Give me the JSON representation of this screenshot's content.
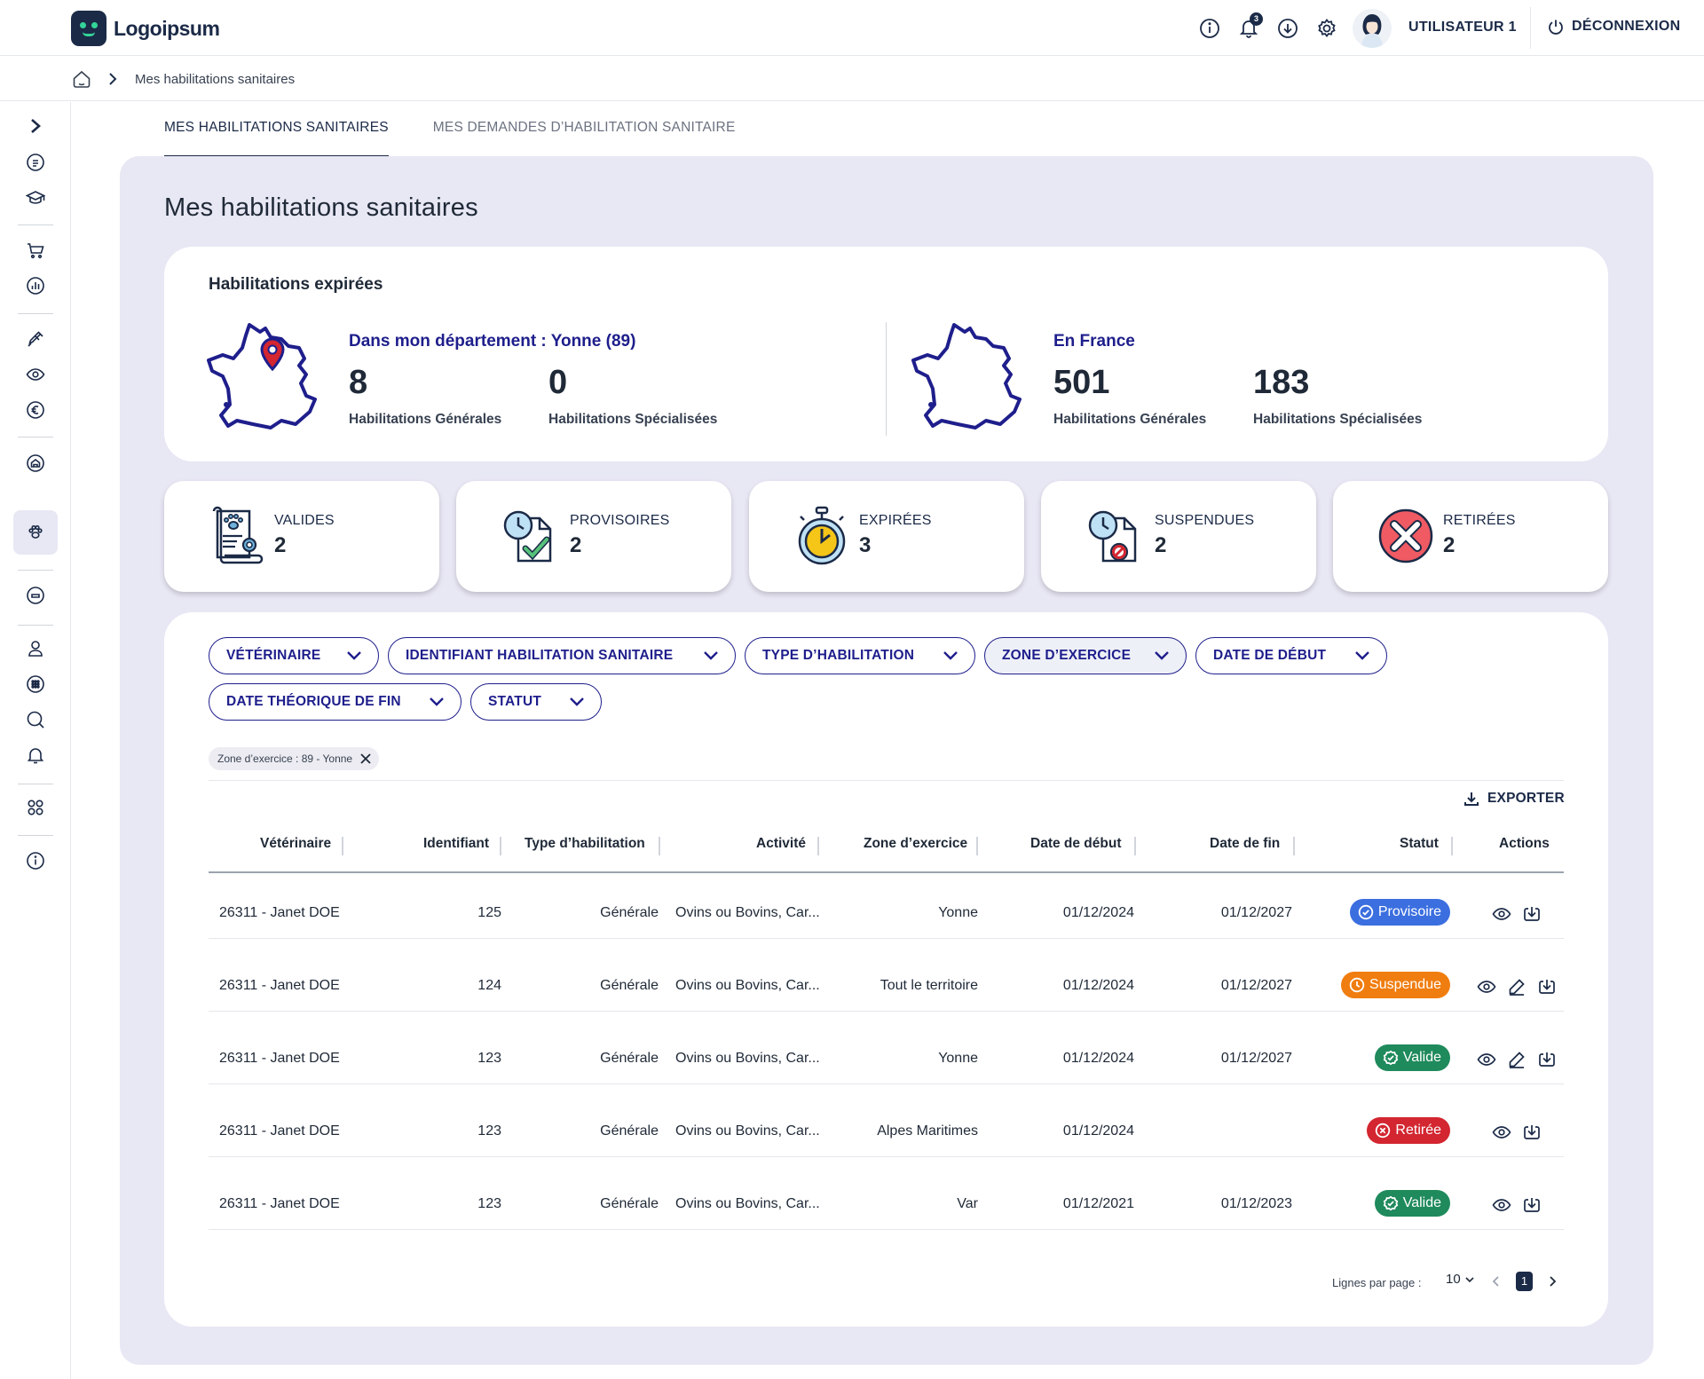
{
  "app": {
    "logo_text": "Logoipsum"
  },
  "header": {
    "notification_count": "3",
    "user_name": "UTILISATEUR 1",
    "logout_label": "DÉCONNEXION"
  },
  "breadcrumb": {
    "current": "Mes habilitations sanitaires"
  },
  "tabs": [
    {
      "label": "MES HABILITATIONS SANITAIRES",
      "active": true
    },
    {
      "label": "MES DEMANDES D’HABILITATION SANITAIRE",
      "active": false
    }
  ],
  "page_title": "Mes habilitations sanitaires",
  "expired": {
    "title": "Habilitations expirées",
    "department": {
      "title": "Dans mon département : Yonne (89)",
      "general_value": "8",
      "general_label": "Habilitations Générales",
      "special_value": "0",
      "special_label": "Habilitations Spécialisées"
    },
    "france": {
      "title": "En France",
      "general_value": "501",
      "general_label": "Habilitations Générales",
      "special_value": "183",
      "special_label": "Habilitations Spécialisées"
    }
  },
  "stats": [
    {
      "label": "VALIDES",
      "value": "2",
      "icon": "certificate-icon"
    },
    {
      "label": "PROVISOIRES",
      "value": "2",
      "icon": "clock-document-check-icon"
    },
    {
      "label": "EXPIRÉES",
      "value": "3",
      "icon": "stopwatch-icon"
    },
    {
      "label": "SUSPENDUES",
      "value": "2",
      "icon": "clock-document-forbidden-icon"
    },
    {
      "label": "RETIRÉES",
      "value": "2",
      "icon": "red-cross-icon"
    }
  ],
  "filters": [
    {
      "label": "VÉTÉRINAIRE"
    },
    {
      "label": "IDENTIFIANT HABILITATION SANITAIRE"
    },
    {
      "label": "TYPE D’HABILITATION"
    },
    {
      "label": "ZONE D’EXERCICE"
    },
    {
      "label": "DATE DE DÉBUT"
    },
    {
      "label": "DATE THÉORIQUE DE FIN"
    },
    {
      "label": "STATUT"
    }
  ],
  "active_filter_chip": "Zone d’exercice : 89 - Yonne",
  "export_label": "EXPORTER",
  "table": {
    "columns": [
      "Vétérinaire",
      "Identifiant",
      "Type d’habilitation",
      "Activité",
      "Zone d’exercice",
      "Date de début",
      "Date de fin",
      "Statut",
      "Actions"
    ],
    "rows": [
      {
        "vet": "26311 - Janet DOE",
        "id": "125",
        "type": "Générale",
        "activity": "Ovins ou Bovins, Car...",
        "zone": "Yonne",
        "start": "01/12/2024",
        "end": "01/12/2027",
        "status": "Provisoire",
        "status_color": "#3b6fe0",
        "actions": [
          "eye-icon",
          "download-icon"
        ]
      },
      {
        "vet": "26311 - Janet DOE",
        "id": "124",
        "type": "Générale",
        "activity": "Ovins ou Bovins, Car...",
        "zone": "Tout le territoire",
        "start": "01/12/2024",
        "end": "01/12/2027",
        "status": "Suspendue",
        "status_color": "#f07d0f",
        "actions": [
          "eye-icon",
          "pen-icon",
          "download-icon"
        ]
      },
      {
        "vet": "26311 - Janet DOE",
        "id": "123",
        "type": "Générale",
        "activity": "Ovins ou Bovins, Car...",
        "zone": "Yonne",
        "start": "01/12/2024",
        "end": "01/12/2027",
        "status": "Valide",
        "status_color": "#1f8a5c",
        "actions": [
          "eye-icon",
          "pen-icon",
          "download-icon"
        ]
      },
      {
        "vet": "26311 - Janet DOE",
        "id": "123",
        "type": "Générale",
        "activity": "Ovins ou Bovins, Car...",
        "zone": "Alpes Maritimes",
        "start": "01/12/2024",
        "end": "",
        "status": "Retirée",
        "status_color": "#d32630",
        "actions": [
          "eye-icon",
          "download-icon"
        ]
      },
      {
        "vet": "26311 - Janet DOE",
        "id": "123",
        "type": "Générale",
        "activity": "Ovins ou Bovins, Car...",
        "zone": "Var",
        "start": "01/12/2021",
        "end": "01/12/2023",
        "status": "Valide",
        "status_color": "#1f8a5c",
        "actions": [
          "eye-icon",
          "download-icon"
        ]
      }
    ]
  },
  "pagination": {
    "rows_per_page_label": "Lignes par page :",
    "rows_per_page": "10",
    "current_page": "1"
  },
  "colors": {
    "navy": "#1b2a47",
    "accent_blue": "#1e1e8c",
    "panel_bg": "#e8e7f4"
  }
}
